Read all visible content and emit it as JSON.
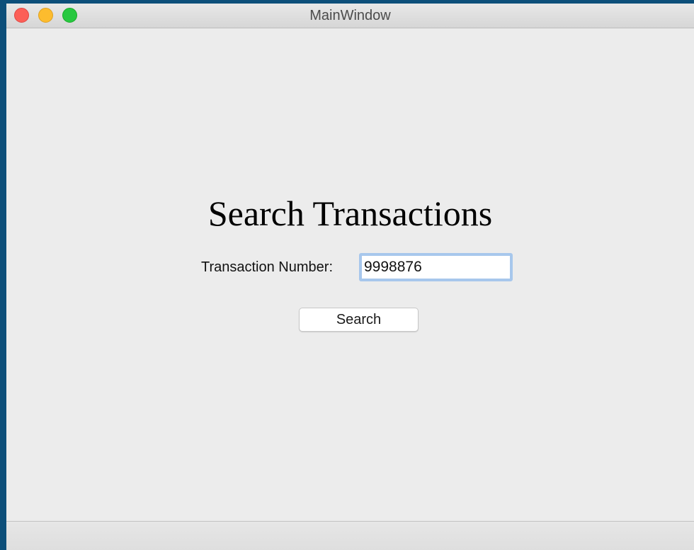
{
  "window": {
    "title": "MainWindow",
    "controls": [
      "close-button",
      "minimize-button",
      "zoom-button"
    ]
  },
  "main": {
    "heading": "Search Transactions",
    "transaction_field": {
      "label": "Transaction Number:",
      "value": "9998876"
    },
    "search_button_label": "Search"
  },
  "colors": {
    "desktop_background": "#0d4f7a",
    "window_background": "#ececec",
    "close": "#fc5f57",
    "minimize": "#fdbc2e",
    "zoom": "#28c840",
    "focus_ring": "#a7c7ec"
  }
}
